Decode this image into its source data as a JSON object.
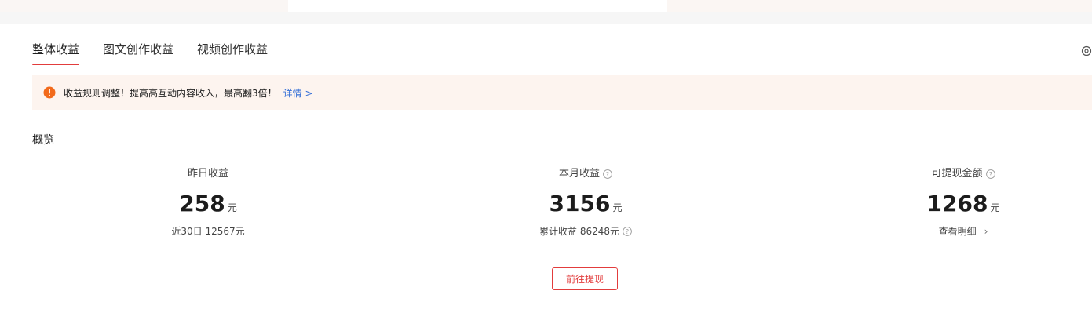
{
  "tabs": [
    {
      "label": "整体收益",
      "active": true
    },
    {
      "label": "图文创作收益",
      "active": false
    },
    {
      "label": "视频创作收益",
      "active": false
    }
  ],
  "notice": {
    "icon": "exclamation-circle-icon",
    "text": "收益规则调整！提高高互动内容收入，最高翻3倍！",
    "link": "详情 >"
  },
  "overview": {
    "title": "概览",
    "stats": [
      {
        "label": "昨日收益",
        "value": "258",
        "unit": "元",
        "sub": "近30日 12567元",
        "has_help": false,
        "sub_help": false,
        "sub_link": false
      },
      {
        "label": "本月收益",
        "value": "3156",
        "unit": "元",
        "sub": "累计收益 86248元",
        "has_help": true,
        "sub_help": true,
        "sub_link": false
      },
      {
        "label": "可提现金额",
        "value": "1268",
        "unit": "元",
        "sub": "查看明细",
        "has_help": true,
        "sub_help": false,
        "sub_link": true
      }
    ],
    "withdraw_button": "前往提现"
  },
  "colors": {
    "accent": "#e23c3c",
    "link": "#2f6bd6",
    "notice_bg": "#fdf4ef",
    "notice_icon": "#f26a1b"
  }
}
